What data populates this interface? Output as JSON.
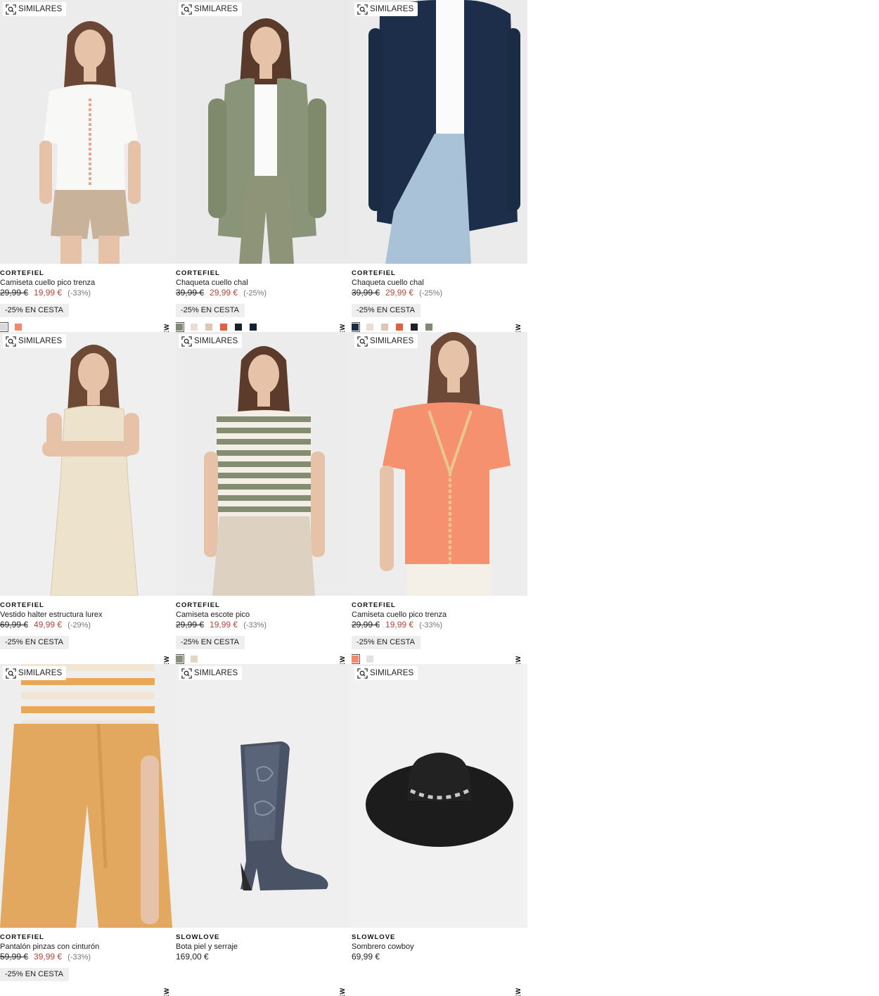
{
  "similar_label": "SIMILARES",
  "new_label": "NEW",
  "products": [
    {
      "brand": "CORTEFIEL",
      "name": "Camiseta cuello pico trenza",
      "old_price": "29,99 €",
      "price": "19,99 €",
      "discount": "(-33%)",
      "promo": "-25% EN CESTA",
      "bg": "#ececec",
      "garment": "white-tee",
      "colors": [
        "#d9d9d9",
        "#f08a6e"
      ]
    },
    {
      "brand": "CORTEFIEL",
      "name": "Chaqueta cuello chal",
      "old_price": "39,99 €",
      "price": "29,99 €",
      "discount": "(-25%)",
      "promo": "-25% EN CESTA",
      "bg": "#eaeaea",
      "garment": "olive-cardigan",
      "colors": [
        "#7f8a72",
        "#ecdcd6",
        "#ddc6b4",
        "#e0603f",
        "#1d2226",
        "#122338"
      ]
    },
    {
      "brand": "CORTEFIEL",
      "name": "Chaqueta cuello chal",
      "old_price": "39,99 €",
      "price": "29,99 €",
      "discount": "(-25%)",
      "promo": "-25% EN CESTA",
      "bg": "#ebebeb",
      "garment": "navy-cardigan",
      "colors": [
        "#1b2b44",
        "#ecdcd6",
        "#ddc6b4",
        "#e0603f",
        "#1d2226",
        "#7f8a72"
      ]
    },
    {
      "brand": "CORTEFIEL",
      "name": "Vestido halter estructura lurex",
      "old_price": "69,99 €",
      "price": "49,99 €",
      "discount": "(-29%)",
      "promo": "-25% EN CESTA",
      "bg": "#efefef",
      "garment": "cream-dress",
      "colors": []
    },
    {
      "brand": "CORTEFIEL",
      "name": "Camiseta escote pico",
      "old_price": "29,99 €",
      "price": "19,99 €",
      "discount": "(-33%)",
      "promo": "-25% EN CESTA",
      "bg": "#ececec",
      "garment": "striped-tee",
      "colors": [
        "#8a917a",
        "#e3d6c4"
      ]
    },
    {
      "brand": "CORTEFIEL",
      "name": "Camiseta cuello pico trenza",
      "old_price": "29,99 €",
      "price": "19,99 €",
      "discount": "(-33%)",
      "promo": "-25% EN CESTA",
      "bg": "#ededed",
      "garment": "coral-tee",
      "colors": [
        "#f08a6e",
        "#e2e2e2"
      ]
    },
    {
      "brand": "CORTEFIEL",
      "name": "Pantalón pinzas con cinturón",
      "old_price": "59,99 €",
      "price": "39,99 €",
      "discount": "(-33%)",
      "promo": "-25% EN CESTA",
      "bg": "#eeeeee",
      "garment": "ochre-pants",
      "colors": []
    },
    {
      "brand": "SLOWLOVE",
      "name": "Bota piel y serraje",
      "old_price": "",
      "price": "169,00 €",
      "discount": "",
      "promo": "",
      "bg": "#efefef",
      "garment": "boot",
      "colors": []
    },
    {
      "brand": "SLOWLOVE",
      "name": "Sombrero cowboy",
      "old_price": "",
      "price": "69,99 €",
      "discount": "",
      "promo": "",
      "bg": "#f1f1f1",
      "garment": "hat",
      "colors": []
    }
  ]
}
